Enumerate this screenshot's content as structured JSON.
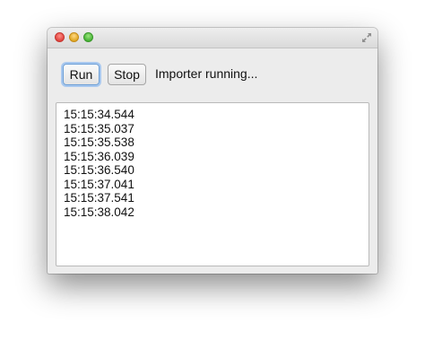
{
  "toolbar": {
    "run_label": "Run",
    "stop_label": "Stop",
    "status_text": "Importer running..."
  },
  "log": {
    "lines": [
      "15:15:34.544",
      "15:15:35.037",
      "15:15:35.538",
      "15:15:36.039",
      "15:15:36.540",
      "15:15:37.041",
      "15:15:37.541",
      "15:15:38.042"
    ]
  },
  "titlebar": {
    "icons": [
      "close-icon",
      "minimize-icon",
      "zoom-icon",
      "fullscreen-icon"
    ]
  }
}
